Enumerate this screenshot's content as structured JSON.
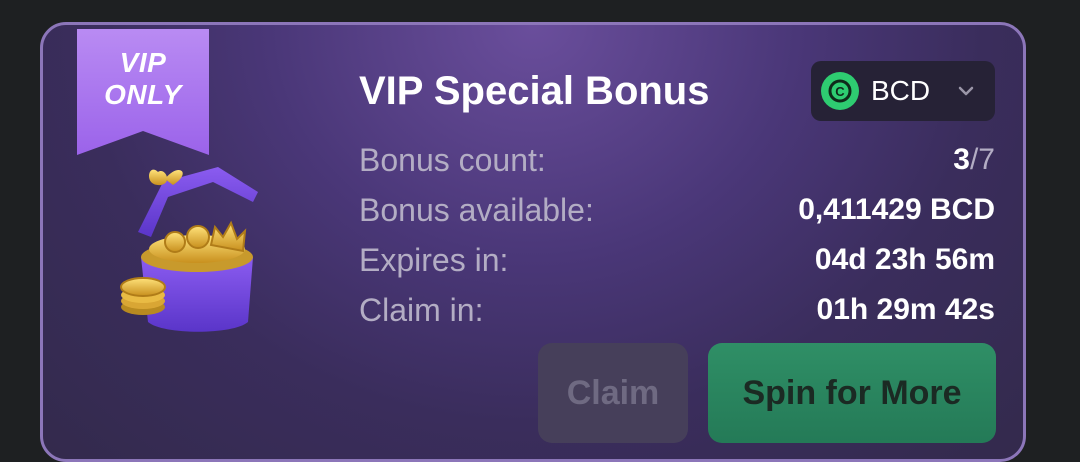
{
  "badge": {
    "line1": "VIP",
    "line2": "ONLY"
  },
  "title": "VIP Special Bonus",
  "currency_selector": {
    "code": "BCD",
    "icon": "bcd-coin-icon",
    "dropdown_icon": "chevron-down-icon",
    "accent": "#2ecc71"
  },
  "stats": [
    {
      "label": "Bonus count:",
      "value_current": "3",
      "value_total": "/7"
    },
    {
      "label": "Bonus available:",
      "value": "0,411429 BCD"
    },
    {
      "label": "Expires in:",
      "value": "04d 23h 56m"
    },
    {
      "label": "Claim in:",
      "value": "01h 29m 42s"
    }
  ],
  "actions": {
    "claim_label": "Claim",
    "spin_label": "Spin for More"
  },
  "colors": {
    "card_border": "#8c76b9",
    "ribbon": "#9b63ea",
    "spin_button": "#2f8f66",
    "claim_button_disabled": "#463f5a"
  }
}
